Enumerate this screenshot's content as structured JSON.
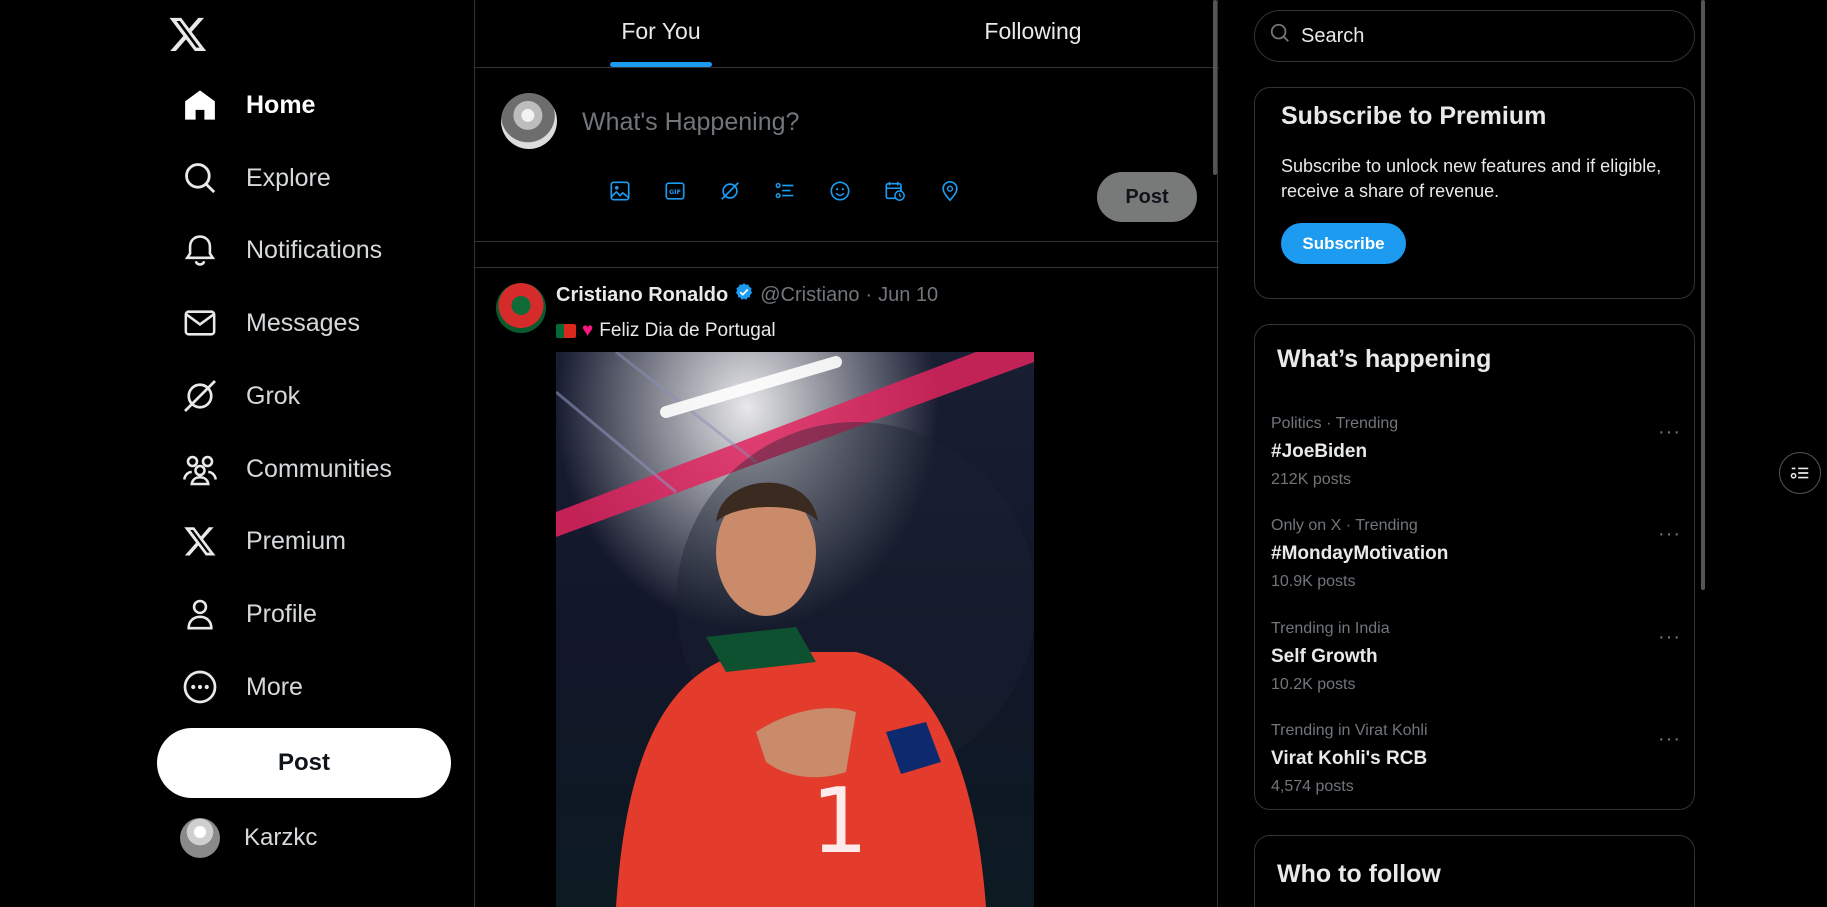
{
  "nav": {
    "logo": "x-logo-icon",
    "items": [
      {
        "label": "Home",
        "icon": "home-icon"
      },
      {
        "label": "Explore",
        "icon": "search-icon"
      },
      {
        "label": "Notifications",
        "icon": "bell-icon"
      },
      {
        "label": "Messages",
        "icon": "mail-icon"
      },
      {
        "label": "Grok",
        "icon": "grok-icon"
      },
      {
        "label": "Communities",
        "icon": "people-icon"
      },
      {
        "label": "Premium",
        "icon": "x-logo-icon"
      },
      {
        "label": "Profile",
        "icon": "person-icon"
      },
      {
        "label": "More",
        "icon": "more-circle-icon"
      }
    ],
    "post_label": "Post",
    "account_name": "Karzkc"
  },
  "tabs": {
    "for_you": "For You",
    "following": "Following"
  },
  "compose": {
    "placeholder": "What's Happening?",
    "post_label": "Post"
  },
  "tweet": {
    "name": "Cristiano Ronaldo",
    "handle": "@Cristiano",
    "separator": "·",
    "date": "Jun 10",
    "text": "Feliz Dia de Portugal"
  },
  "search": {
    "placeholder": "Search"
  },
  "premium": {
    "title": "Subscribe to Premium",
    "body": "Subscribe to unlock new features and if eligible, receive a share of revenue.",
    "button": "Subscribe"
  },
  "happening": {
    "title": "What’s happening",
    "trends": [
      {
        "meta": "Politics · Trending",
        "title": "#JoeBiden",
        "count": "212K posts"
      },
      {
        "meta": "Only on X · Trending",
        "title": "#MondayMotivation",
        "count": "10.9K posts"
      },
      {
        "meta": "Trending in India",
        "title": "Self Growth",
        "count": "10.2K posts"
      },
      {
        "meta": "Trending in Virat Kohli",
        "title": "Virat Kohli's RCB",
        "count": "4,574 posts"
      }
    ],
    "more_glyph": "···"
  },
  "follow": {
    "title": "Who to follow"
  },
  "colors": {
    "accent": "#1d9bf0",
    "background": "#000000",
    "border": "#2f3336",
    "muted": "#71767b"
  }
}
